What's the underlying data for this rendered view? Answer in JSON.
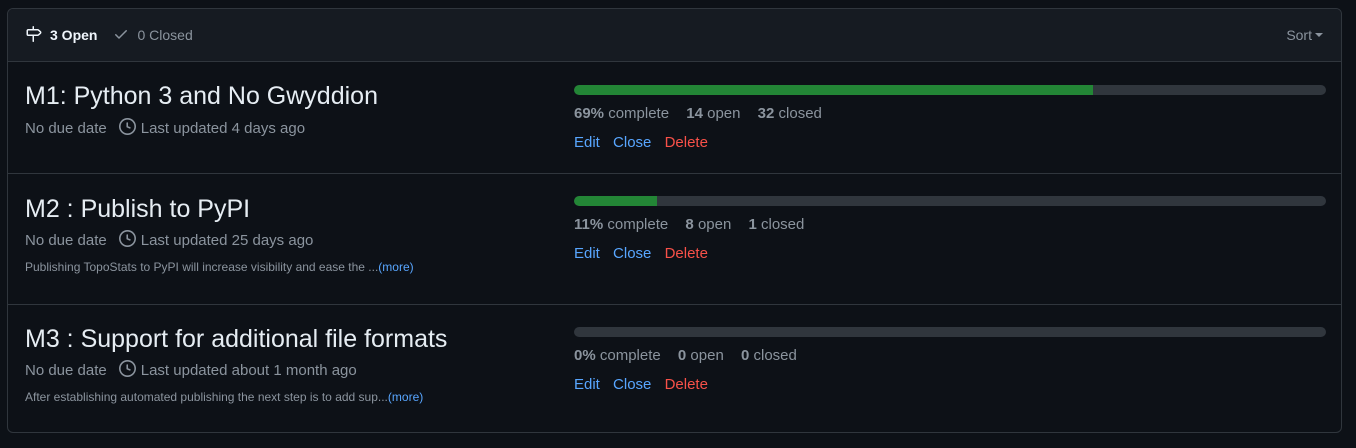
{
  "header": {
    "open_label": "3 Open",
    "closed_label": "0 Closed",
    "sort_label": "Sort"
  },
  "colors": {
    "accent_blue": "#58a6ff",
    "progress_green": "#238636",
    "danger_red": "#f85149"
  },
  "milestones": [
    {
      "title": "M1: Python 3 and No Gwyddion",
      "due": "No due date",
      "updated": "Last updated 4 days ago",
      "description": "",
      "more": "",
      "percent_complete": 69,
      "percent_text": "69%",
      "open_count": "14",
      "closed_count": "32"
    },
    {
      "title": "M2 : Publish to PyPI",
      "due": "No due date",
      "updated": "Last updated 25 days ago",
      "description": "Publishing TopoStats to PyPI will increase visibility and ease the ...",
      "more": "(more)",
      "percent_complete": 11,
      "percent_text": "11%",
      "open_count": "8",
      "closed_count": "1"
    },
    {
      "title": "M3 : Support for additional file formats",
      "due": "No due date",
      "updated": "Last updated about 1 month ago",
      "description": "After establishing automated publishing the next step is to add sup...",
      "more": "(more)",
      "percent_complete": 0,
      "percent_text": "0%",
      "open_count": "0",
      "closed_count": "0"
    }
  ],
  "labels": {
    "complete": "complete",
    "open": "open",
    "closed": "closed",
    "edit": "Edit",
    "close": "Close",
    "delete": "Delete"
  }
}
